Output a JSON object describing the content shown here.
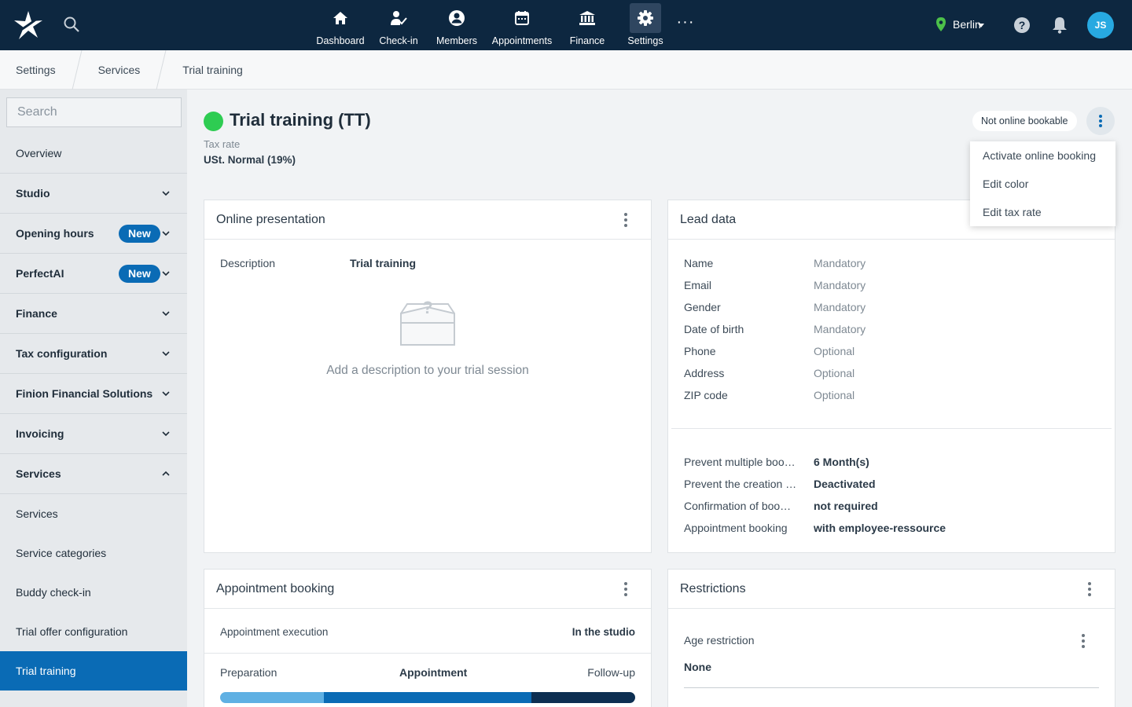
{
  "nav": {
    "items": [
      {
        "label": "Dashboard",
        "icon": "home-icon"
      },
      {
        "label": "Check-in",
        "icon": "check-in-icon"
      },
      {
        "label": "Members",
        "icon": "members-icon"
      },
      {
        "label": "Appointments",
        "icon": "calendar-icon"
      },
      {
        "label": "Finance",
        "icon": "bank-icon"
      },
      {
        "label": "Settings",
        "icon": "gear-icon",
        "active": true
      }
    ],
    "more": "···",
    "location": "Berlin",
    "avatar_initials": "JS"
  },
  "breadcrumb": [
    "Settings",
    "Services",
    "Trial training"
  ],
  "sidebar": {
    "search_placeholder": "Search",
    "items": [
      {
        "label": "Overview"
      },
      {
        "label": "Studio"
      },
      {
        "label": "Opening hours",
        "badge": "New"
      },
      {
        "label": "PerfectAI",
        "badge": "New"
      },
      {
        "label": "Finance"
      },
      {
        "label": "Tax configuration"
      },
      {
        "label": "Finion Financial Solutions"
      },
      {
        "label": "Invoicing"
      },
      {
        "label": "Services",
        "expanded": true
      }
    ],
    "sub_items": [
      {
        "label": "Services"
      },
      {
        "label": "Service categories"
      },
      {
        "label": "Buddy check-in"
      },
      {
        "label": "Trial offer configuration"
      },
      {
        "label": "Trial training",
        "active": true
      }
    ]
  },
  "header": {
    "title": "Trial training (TT)",
    "status_color": "#2ecc52",
    "tax_label": "Tax rate",
    "tax_value": "USt. Normal (19%)",
    "online_status": "Not online bookable"
  },
  "menu": {
    "items": [
      "Activate online booking",
      "Edit color",
      "Edit tax rate"
    ]
  },
  "online_presentation": {
    "title": "Online presentation",
    "description_label": "Description",
    "description_value": "Trial training",
    "empty_text": "Add a description to your trial session"
  },
  "lead_data": {
    "title": "Lead data",
    "fields": [
      {
        "label": "Name",
        "value": "Mandatory"
      },
      {
        "label": "Email",
        "value": "Mandatory"
      },
      {
        "label": "Gender",
        "value": "Mandatory"
      },
      {
        "label": "Date of birth",
        "value": "Mandatory"
      },
      {
        "label": "Phone",
        "value": "Optional"
      },
      {
        "label": "Address",
        "value": "Optional"
      },
      {
        "label": "ZIP code",
        "value": "Optional"
      }
    ],
    "settings": [
      {
        "label": "Prevent multiple boo…",
        "value": "6 Month(s)"
      },
      {
        "label": "Prevent the creation …",
        "value": "Deactivated"
      },
      {
        "label": "Confirmation of boo…",
        "value": "not required"
      },
      {
        "label": "Appointment booking",
        "value": "with employee-ressource"
      }
    ]
  },
  "appointment_booking": {
    "title": "Appointment booking",
    "execution_label": "Appointment execution",
    "execution_value": "In the studio",
    "phases": {
      "preparation": "Preparation",
      "appointment": "Appointment",
      "follow_up": "Follow-up"
    },
    "phase_colors": [
      "#5fb0e3",
      "#0a6bb5",
      "#0d2f52"
    ]
  },
  "restrictions": {
    "title": "Restrictions",
    "age_label": "Age restriction",
    "age_value": "None"
  }
}
